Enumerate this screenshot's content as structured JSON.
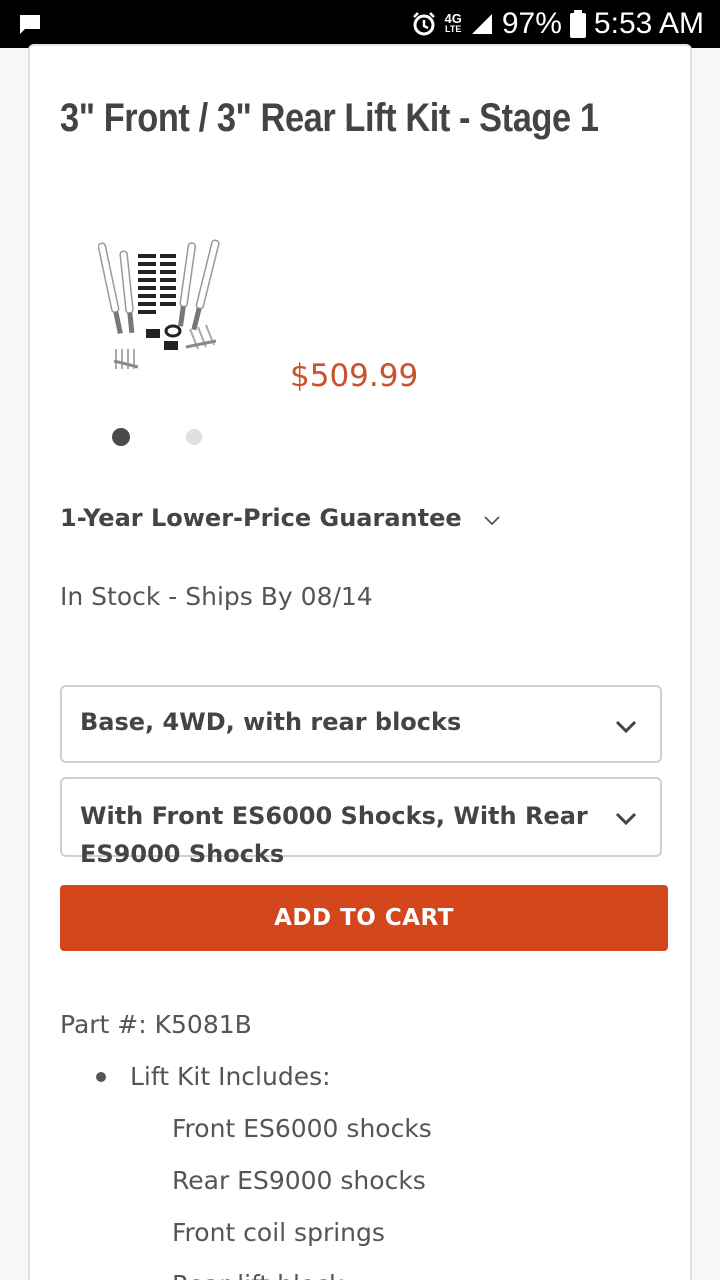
{
  "status_bar": {
    "network": "4G LTE",
    "battery": "97%",
    "time": "5:53 AM",
    "icons": [
      "message-icon",
      "alarm-icon",
      "signal-icon",
      "battery-icon"
    ]
  },
  "product": {
    "title": "3\" Front / 3\" Rear Lift Kit - Stage 1",
    "price": "$509.99",
    "price_color": "#c9522c",
    "carousel": {
      "total": 2,
      "active_index": 0
    }
  },
  "guarantee": {
    "label": "1-Year Lower-Price Guarantee"
  },
  "stock": {
    "text": "In Stock - Ships By 08/14"
  },
  "options": {
    "option_1": "Base, 4WD, with rear blocks",
    "option_2": "With Front ES6000 Shocks, With Rear ES9000 Shocks"
  },
  "cart": {
    "button_label": "ADD TO CART",
    "color": "#d4461c"
  },
  "details": {
    "part_label": "Part #:",
    "part_number": "K5081B",
    "includes_label": "Lift Kit Includes:",
    "items": [
      "Front ES6000 shocks",
      "Rear ES9000 shocks",
      "Front coil springs",
      "Rear lift block"
    ]
  }
}
